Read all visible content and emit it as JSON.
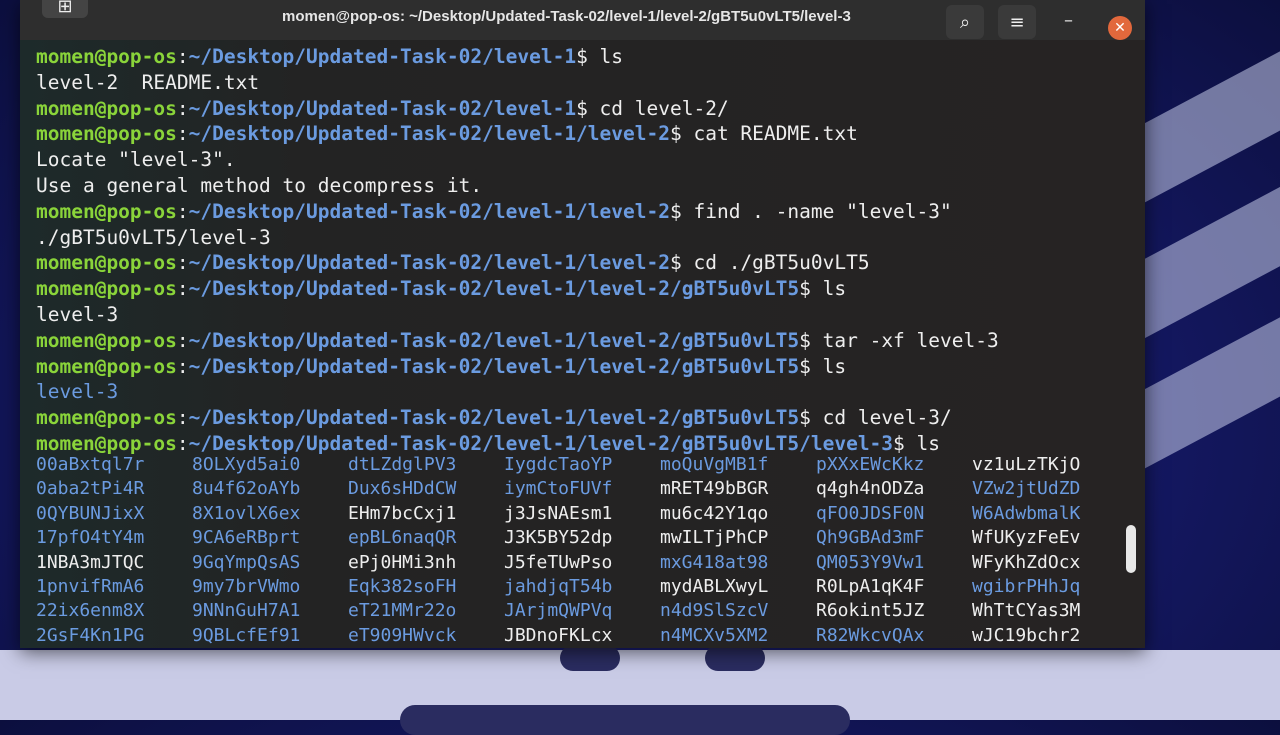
{
  "window": {
    "title": "momen@pop-os: ~/Desktop/Updated-Task-02/level-1/level-2/gBT5u0vLT5/level-3",
    "icons": {
      "search": "search-icon",
      "menu": "hamburger-menu-icon",
      "minimize": "minimize-icon",
      "close": "close-icon"
    },
    "glyphs": {
      "search": "⌕",
      "menu": "≡",
      "minimize": "–",
      "close": "✕",
      "left": "⊞"
    }
  },
  "colors": {
    "user": "#8ad43a",
    "path": "#6b9be0",
    "text": "#eeeeee",
    "close": "#e2683c"
  },
  "terminal": {
    "user": "momen@pop-os",
    "lines": [
      {
        "path": "~/Desktop/Updated-Task-02/level-1",
        "cmd": " ls"
      },
      {
        "out": "level-2  README.txt"
      },
      {
        "path": "~/Desktop/Updated-Task-02/level-1",
        "cmd": " cd level-2/"
      },
      {
        "path": "~/Desktop/Updated-Task-02/level-1/level-2",
        "cmd": " cat README.txt"
      },
      {
        "out": "Locate \"level-3\"."
      },
      {
        "out": "Use a general method to decompress it."
      },
      {
        "path": "~/Desktop/Updated-Task-02/level-1/level-2",
        "cmd": " find . -name \"level-3\""
      },
      {
        "out": "./gBT5u0vLT5/level-3"
      },
      {
        "path": "~/Desktop/Updated-Task-02/level-1/level-2",
        "cmd": " cd ./gBT5u0vLT5"
      },
      {
        "path": "~/Desktop/Updated-Task-02/level-1/level-2/gBT5u0vLT5",
        "cmd": " ls"
      },
      {
        "out": "level-3"
      },
      {
        "path": "~/Desktop/Updated-Task-02/level-1/level-2/gBT5u0vLT5",
        "cmd": " tar -xf level-3"
      },
      {
        "path": "~/Desktop/Updated-Task-02/level-1/level-2/gBT5u0vLT5",
        "cmd": " ls"
      },
      {
        "out": "level-3",
        "dir": true
      },
      {
        "path": "~/Desktop/Updated-Task-02/level-1/level-2/gBT5u0vLT5",
        "cmd": " cd level-3/"
      },
      {
        "path": "~/Desktop/Updated-Task-02/level-1/level-2/gBT5u0vLT5/level-3",
        "cmd": " ls"
      }
    ],
    "ls_listing": [
      [
        {
          "n": "00aBxtql7r",
          "d": true
        },
        {
          "n": "8OLXyd5ai0",
          "d": true
        },
        {
          "n": "dtLZdglPV3",
          "d": true
        },
        {
          "n": "IygdcTaoYP",
          "d": true
        },
        {
          "n": "moQuVgMB1f",
          "d": true
        },
        {
          "n": "pXXxEWcKkz",
          "d": true
        },
        {
          "n": "vz1uLzTKjO",
          "d": false
        }
      ],
      [
        {
          "n": "0aba2tPi4R",
          "d": true
        },
        {
          "n": "8u4f62oAYb",
          "d": true
        },
        {
          "n": "Dux6sHDdCW",
          "d": true
        },
        {
          "n": "iymCtoFUVf",
          "d": true
        },
        {
          "n": "mRET49bBGR",
          "d": false
        },
        {
          "n": "q4gh4nODZa",
          "d": false
        },
        {
          "n": "VZw2jtUdZD",
          "d": true
        }
      ],
      [
        {
          "n": "0QYBUNJixX",
          "d": true
        },
        {
          "n": "8X1ovlX6ex",
          "d": true
        },
        {
          "n": "EHm7bcCxj1",
          "d": false
        },
        {
          "n": "j3JsNAEsm1",
          "d": false
        },
        {
          "n": "mu6c42Y1qo",
          "d": false
        },
        {
          "n": "qFO0JDSF0N",
          "d": true
        },
        {
          "n": "W6AdwbmalK",
          "d": true
        }
      ],
      [
        {
          "n": "17pfO4tY4m",
          "d": true
        },
        {
          "n": "9CA6eRBprt",
          "d": true
        },
        {
          "n": "epBL6naqQR",
          "d": true
        },
        {
          "n": "J3K5BY52dp",
          "d": false
        },
        {
          "n": "mwILTjPhCP",
          "d": false
        },
        {
          "n": "Qh9GBAd3mF",
          "d": true
        },
        {
          "n": "WfUKyzFeEv",
          "d": false
        }
      ],
      [
        {
          "n": "1NBA3mJTQC",
          "d": false
        },
        {
          "n": "9GqYmpQsAS",
          "d": true
        },
        {
          "n": "ePj0HMi3nh",
          "d": false
        },
        {
          "n": "J5feTUwPso",
          "d": false
        },
        {
          "n": "mxG418at98",
          "d": true
        },
        {
          "n": "QM053Y9Vw1",
          "d": true
        },
        {
          "n": "WFyKhZdOcx",
          "d": false
        }
      ],
      [
        {
          "n": "1pnvifRmA6",
          "d": true
        },
        {
          "n": "9my7brVWmo",
          "d": true
        },
        {
          "n": "Eqk382soFH",
          "d": true
        },
        {
          "n": "jahdjqT54b",
          "d": true
        },
        {
          "n": "mydABLXwyL",
          "d": false
        },
        {
          "n": "R0LpA1qK4F",
          "d": false
        },
        {
          "n": "wgibrPHhJq",
          "d": true
        }
      ],
      [
        {
          "n": "22ix6enm8X",
          "d": true
        },
        {
          "n": "9NNnGuH7A1",
          "d": true
        },
        {
          "n": "eT21MMr22o",
          "d": true
        },
        {
          "n": "JArjmQWPVq",
          "d": true
        },
        {
          "n": "n4d9SlSzcV",
          "d": true
        },
        {
          "n": "R6okint5JZ",
          "d": false
        },
        {
          "n": "WhTtCYas3M",
          "d": false
        }
      ],
      [
        {
          "n": "2GsF4Kn1PG",
          "d": true
        },
        {
          "n": "9QBLcfEf91",
          "d": true
        },
        {
          "n": "eT909HWvck",
          "d": true
        },
        {
          "n": "JBDnoFKLcx",
          "d": false
        },
        {
          "n": "n4MCXv5XM2",
          "d": true
        },
        {
          "n": "R82WkcvQAx",
          "d": true
        },
        {
          "n": "wJC19bchr2",
          "d": false
        }
      ]
    ]
  }
}
